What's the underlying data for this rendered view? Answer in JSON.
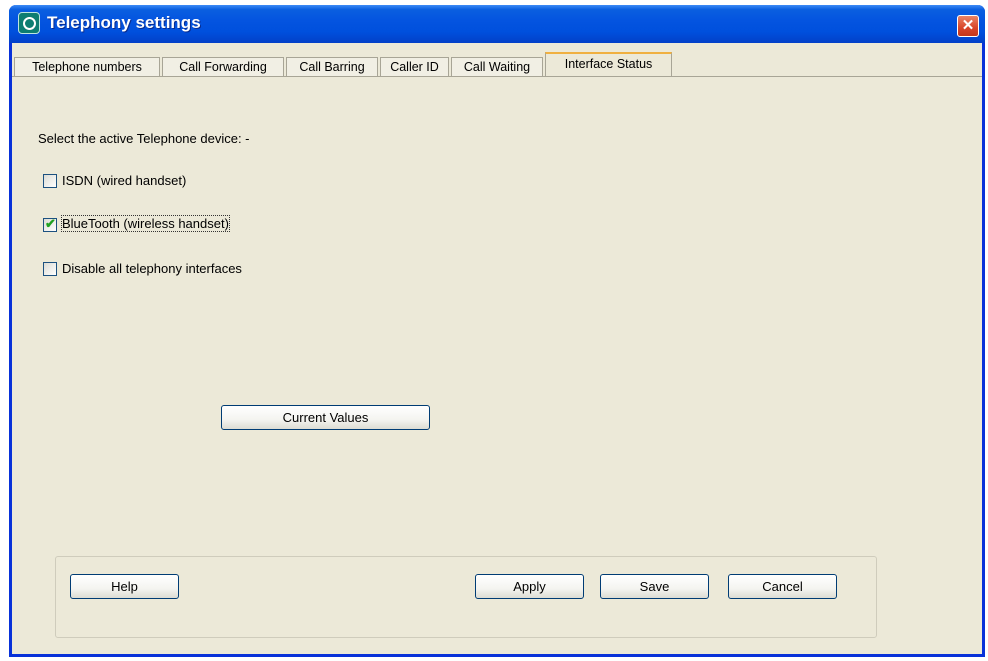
{
  "window": {
    "title": "Telephony settings",
    "close_glyph": "✕"
  },
  "tabs": [
    {
      "label": "Telephone numbers",
      "active": false
    },
    {
      "label": "Call Forwarding",
      "active": false
    },
    {
      "label": "Call Barring",
      "active": false
    },
    {
      "label": "Caller ID",
      "active": false
    },
    {
      "label": "Call Waiting",
      "active": false
    },
    {
      "label": "Interface Status",
      "active": true
    }
  ],
  "content": {
    "prompt": "Select the active Telephone device: -",
    "options": [
      {
        "label": "ISDN (wired handset)",
        "checked": false
      },
      {
        "label": "BlueTooth (wireless handset)",
        "checked": true
      },
      {
        "label": "Disable all telephony interfaces",
        "checked": false
      }
    ],
    "current_values_label": "Current Values"
  },
  "buttons": {
    "help": "Help",
    "apply": "Apply",
    "save": "Save",
    "cancel": "Cancel"
  },
  "icons": {
    "app": "telephony-app-icon",
    "close": "close-icon",
    "check": "checkmark-icon"
  },
  "check_glyph": "✔"
}
